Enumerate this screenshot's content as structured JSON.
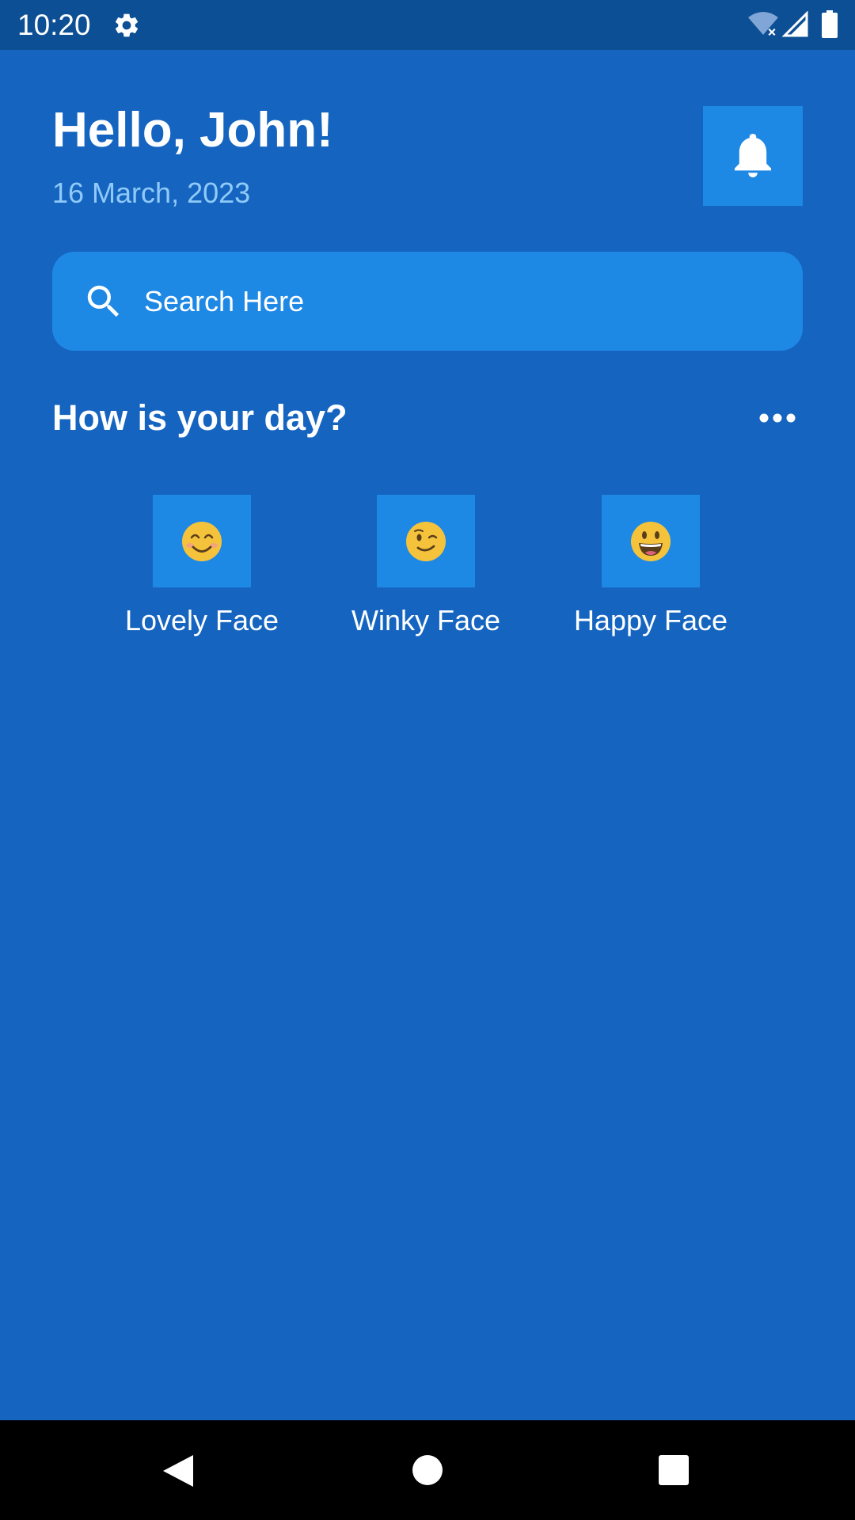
{
  "status_bar": {
    "time": "10:20",
    "icons": [
      "gear-icon",
      "wifi-off-icon",
      "signal-icon",
      "battery-icon"
    ]
  },
  "header": {
    "greeting": "Hello, John!",
    "date": "16 March, 2023",
    "notification_icon": "bell-icon"
  },
  "search": {
    "placeholder": "Search Here",
    "value": "",
    "icon": "search-icon"
  },
  "mood_section": {
    "title": "How is your day?",
    "more_icon": "more-horizontal-icon",
    "moods": [
      {
        "label": "Lovely Face",
        "icon": "smiling-face-icon"
      },
      {
        "label": "Winky Face",
        "icon": "winking-face-icon"
      },
      {
        "label": "Happy Face",
        "icon": "grinning-face-icon"
      }
    ]
  },
  "nav_bar": {
    "icons": [
      "back-icon",
      "home-icon",
      "recents-icon"
    ]
  },
  "colors": {
    "background": "#1565C0",
    "status_bar": "#0D4F94",
    "tile": "#1E88E5",
    "date_text": "#90CAF9",
    "emoji_face": "#F5C33B"
  }
}
